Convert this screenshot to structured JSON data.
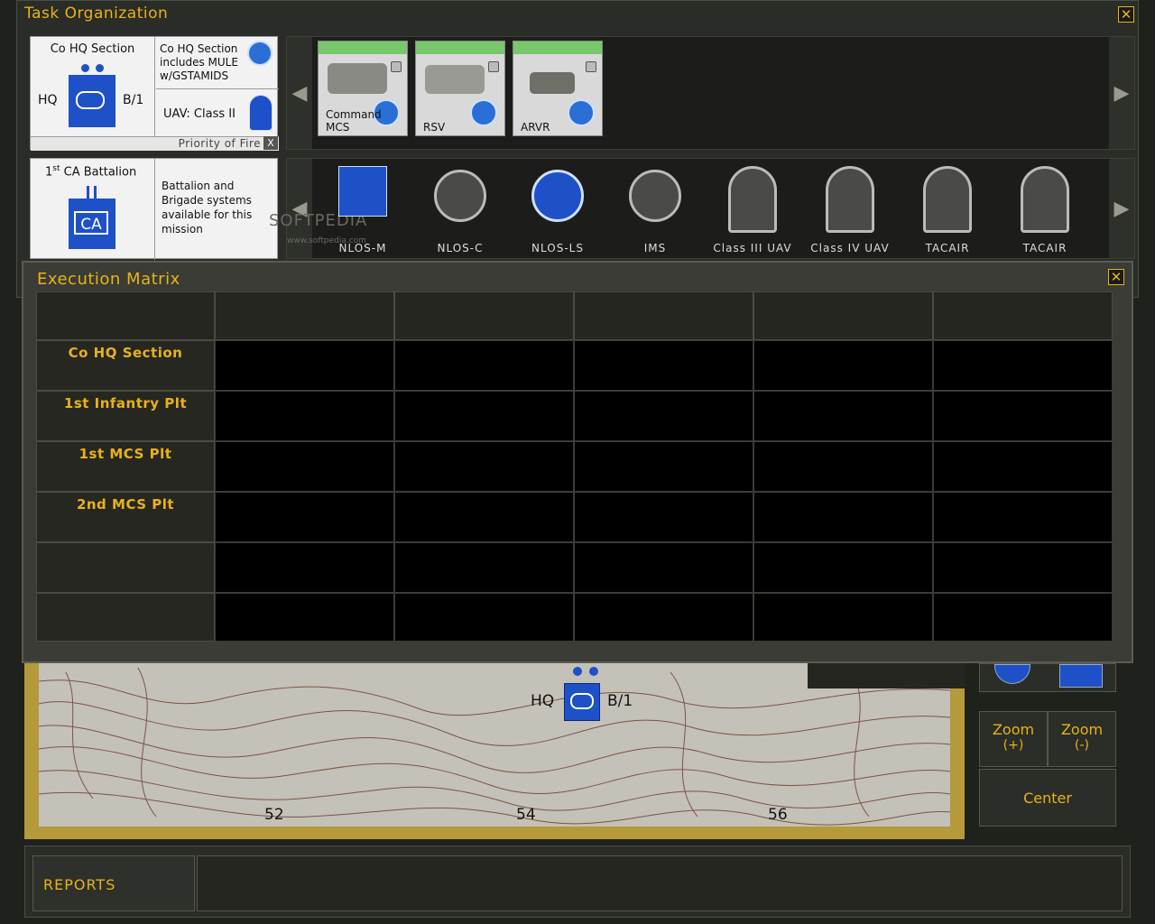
{
  "task_org": {
    "title": "Task Organization",
    "close_label": "✕",
    "hq_card": {
      "title": "Co HQ Section",
      "left_label": "HQ",
      "right_label": "B/1",
      "note": "Co HQ Section includes MULE w/GSTAMIDS",
      "uav_label": "UAV: Class II",
      "priority_label": "Priority of Fire",
      "priority_close": "X"
    },
    "vehicles": [
      {
        "label": "Command MCS"
      },
      {
        "label": "RSV"
      },
      {
        "label": "ARVR"
      }
    ],
    "battalion_card": {
      "title_sup": "st",
      "title_num": "1",
      "title_rest": " CA Battalion",
      "symbol_text": "CA",
      "note": "Battalion and Brigade systems available for this mission"
    },
    "assets": [
      {
        "label": "NLOS-M"
      },
      {
        "label": "NLOS-C"
      },
      {
        "label": "NLOS-LS"
      },
      {
        "label": "IMS"
      },
      {
        "label": "Class III UAV"
      },
      {
        "label": "Class IV UAV"
      },
      {
        "label": "TACAIR"
      },
      {
        "label": "TACAIR"
      }
    ],
    "watermark": "SOFTPEDIA",
    "watermark_url": "www.softpedia.com",
    "arrow_left": "◀",
    "arrow_right": "▶"
  },
  "exec_matrix": {
    "title": "Execution Matrix",
    "close_label": "✕",
    "rows": [
      "Co HQ Section",
      "1st Infantry Plt",
      "1st MCS Plt",
      "2nd MCS Plt",
      "",
      ""
    ]
  },
  "map": {
    "unit_left": "HQ",
    "unit_right": "B/1",
    "ticks": [
      "52",
      "54",
      "56"
    ]
  },
  "controls": {
    "zoom_in": "Zoom",
    "zoom_in_sub": "(+)",
    "zoom_out": "Zoom",
    "zoom_out_sub": "(-)",
    "center": "Center"
  },
  "reports": {
    "label": "REPORTS"
  },
  "colors": {
    "accent": "#e8b21a",
    "unit_blue": "#1e50c8",
    "status_green": "#76c86a"
  }
}
